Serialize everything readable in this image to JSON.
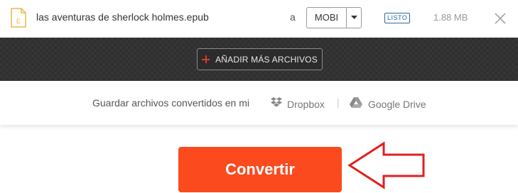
{
  "file": {
    "name": "las aventuras de sherlock holmes.epub",
    "icon_letter": "E",
    "to_label": "a",
    "format": "MOBI",
    "status": "LISTO",
    "size": "1.88 MB"
  },
  "actions": {
    "add_files_label": "AÑADIR MÁS ARCHIVOS"
  },
  "save": {
    "text": "Guardar archivos convertidos en mi",
    "separator": "|",
    "dropbox_label": "Dropbox",
    "gdrive_label": "Google Drive"
  },
  "convert": {
    "label": "Convertir"
  },
  "colors": {
    "accent": "#fb4a1e",
    "arrow": "#e02020",
    "badge": "#2a6aa0",
    "file_icon": "#e8b84a"
  },
  "icons": [
    "file-icon",
    "chevron-down-icon",
    "close-icon",
    "plus-icon",
    "dropbox-icon",
    "google-drive-icon",
    "arrow-annotation"
  ]
}
